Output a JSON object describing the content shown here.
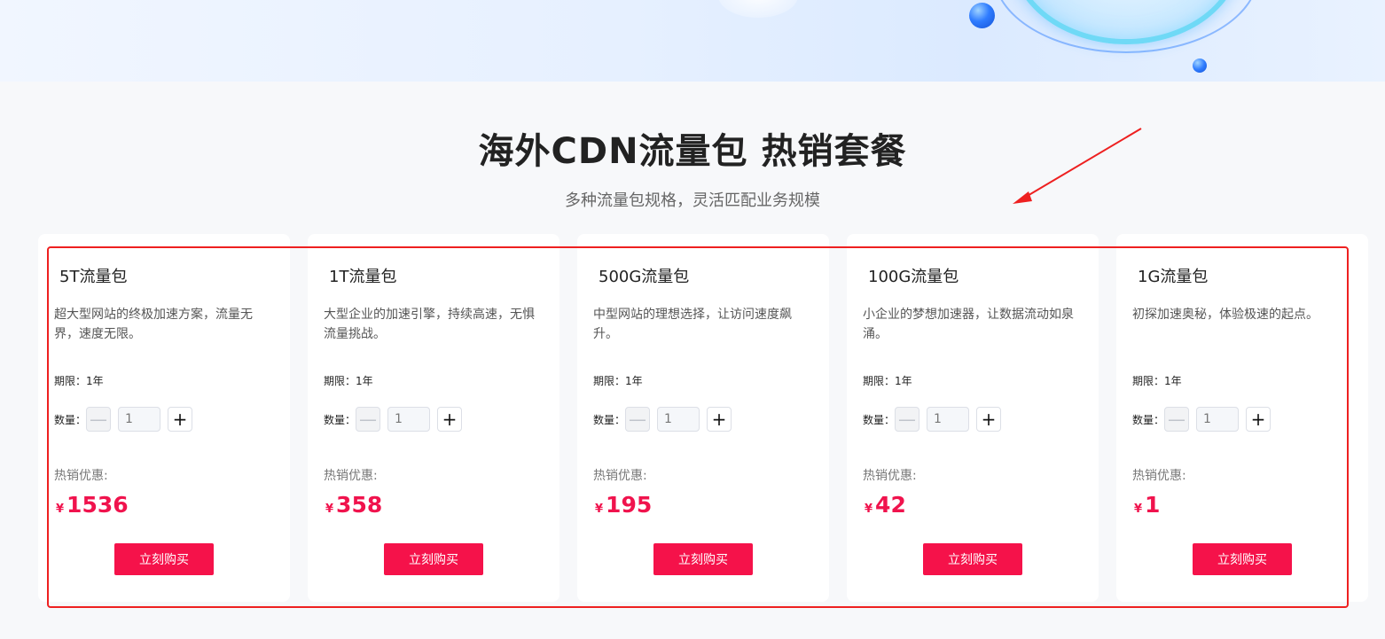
{
  "hero": {
    "banner": "decorative-banner"
  },
  "section": {
    "title": "海外CDN流量包 热销套餐",
    "subtitle": "多种流量包规格，灵活匹配业务规模"
  },
  "labels": {
    "quantity": "数量：",
    "promo": "热销优惠:",
    "currency": "¥",
    "buy": "立刻购买"
  },
  "packages": [
    {
      "name": "5T流量包",
      "desc": "超大型网站的终极加速方案，流量无界，速度无限。",
      "term": "期限：1年",
      "qty": "1",
      "price": "1536"
    },
    {
      "name": "1T流量包",
      "desc": "大型企业的加速引擎，持续高速，无惧流量挑战。",
      "term": "期限：1年",
      "qty": "1",
      "price": "358"
    },
    {
      "name": "500G流量包",
      "desc": "中型网站的理想选择，让访问速度飙升。",
      "term": "期限：1年",
      "qty": "1",
      "price": "195"
    },
    {
      "name": "100G流量包",
      "desc": "小企业的梦想加速器，让数据流动如泉涌。",
      "term": "期限：1年",
      "qty": "1",
      "price": "42"
    },
    {
      "name": "1G流量包",
      "desc": "初探加速奥秘，体验极速的起点。",
      "term": "期限：1年",
      "qty": "1",
      "price": "1"
    }
  ],
  "colors": {
    "accent": "#f5124a",
    "annotation": "#ee2020"
  },
  "icons": {
    "minus": "minus-icon",
    "plus": "plus-icon"
  }
}
